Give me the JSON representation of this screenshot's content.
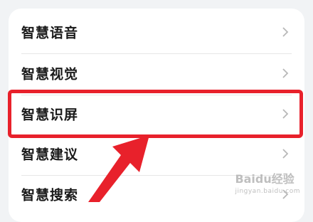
{
  "menu": {
    "items": [
      {
        "label": "智慧语音"
      },
      {
        "label": "智慧视觉"
      },
      {
        "label": "智慧识屏"
      },
      {
        "label": "智慧建议"
      },
      {
        "label": "智慧搜索"
      }
    ]
  },
  "annotation": {
    "highlight_color": "#e8212b",
    "arrow_color": "#e8212b"
  },
  "watermark": {
    "brand": "Baidu经验",
    "url": "jingyan.baidu.com"
  },
  "icons": {
    "row_chevron": "chevron-right-icon",
    "annotation_arrow": "pointer-arrow-icon"
  }
}
